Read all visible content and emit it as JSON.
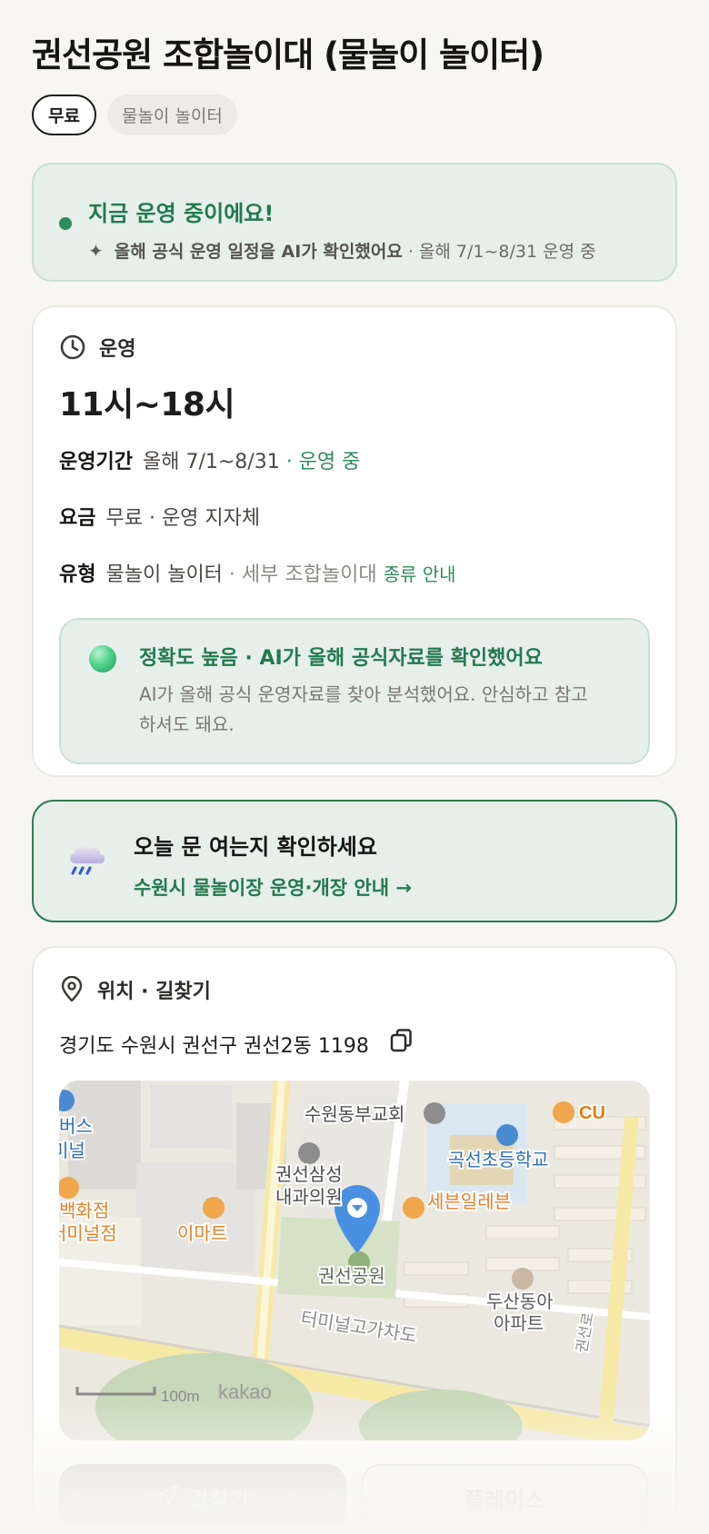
{
  "title": "권선공원 조합놀이대 (물놀이 놀이터)",
  "chips": [
    "무료",
    "물놀이 놀이터"
  ],
  "status": {
    "title": "지금 운영 중이에요!",
    "source": "올해 공식 운영 일정을 AI가 확인했어요",
    "period": "· 올해 7/1~8/31 운영 중"
  },
  "operation": {
    "header": "운영",
    "hours": "11시~18시",
    "period_label": "운영기간",
    "period_value": "올해 7/1~8/31",
    "period_status": "· 운영 중",
    "fee_label": "요금",
    "fee_value": "무료 · 운영 지자체",
    "type_label": "유형",
    "type_value": "물놀이 놀이터",
    "type_detail": "· 세부 조합놀이대",
    "type_link": "종류 안내",
    "accuracy_title": "정확도 높음 · AI가 올해 공식자료를 확인했어요",
    "accuracy_body": "AI가 올해 공식 운영자료를 찾아 분석했어요. 안심하고 참고하셔도 돼요."
  },
  "notice": {
    "title": "오늘 문 여는지 확인하세요",
    "link": "수원시 물놀이장 운영·개장 안내 →"
  },
  "location": {
    "header": "위치 · 길찾기",
    "address": "경기도 수원시 권선구 권선2동 1198",
    "map_labels": {
      "church": "수원동부교회",
      "cu": "CU",
      "school": "곡선초등학교",
      "bus1": "버스",
      "bus2": "미널",
      "clinic1": "권선삼성",
      "clinic2": "내과의원",
      "seven": "세븐일레븐",
      "dept1": "백화점",
      "dept2": "터미널점",
      "emart": "이마트",
      "park": "권선공원",
      "apt1": "두산동아",
      "apt2": "아파트",
      "overpass": "터미널고가차도",
      "road": "권선로",
      "scale": "100m",
      "brand": "kakao"
    },
    "route_button": "길찾기",
    "place_button": "플레이스"
  },
  "colors": {
    "accent_green": "#2f8b5c",
    "status_bg": "#e6efea",
    "map_pin": "#4a90e2"
  }
}
